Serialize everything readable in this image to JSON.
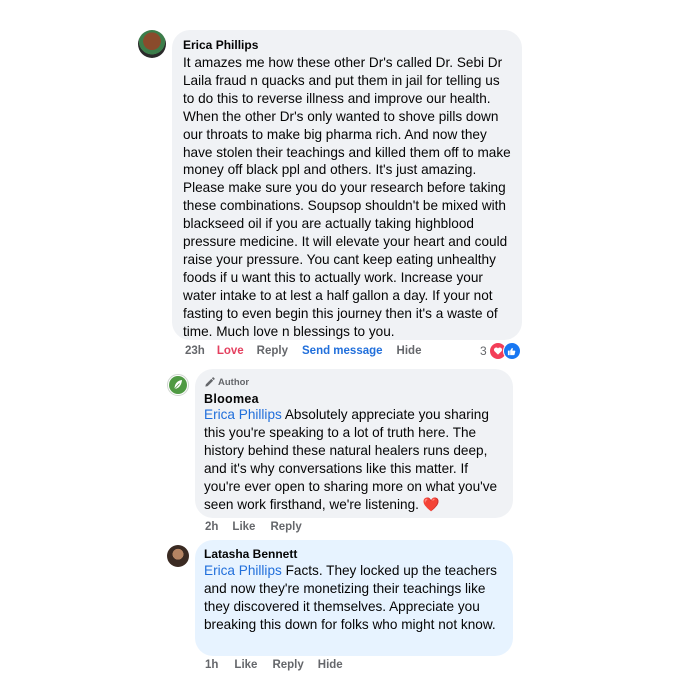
{
  "comments": [
    {
      "author": "Erica Phillips",
      "text": "It amazes me how these other Dr's called Dr. Sebi Dr Laila fraud n quacks and put them in jail for telling us to do this to reverse illness and improve our health. When the other Dr's only wanted to shove pills down our throats to make big pharma rich. And now they have stolen their teachings and killed them off to make money off black ppl and others. It's just amazing. Please make sure you do your research before taking these combinations. Soupsop shouldn't be mixed with blackseed oil if you are actually taking highblood pressure medicine. It will elevate your heart and could raise your pressure. You cant keep eating unhealthy foods if u want this to actually work. Increase your water intake to at lest a half gallon a day. If your not fasting to even begin this journey then it's a waste of time. Much love n blessings to you.",
      "time": "23h",
      "actions": [
        "Love",
        "Reply",
        "Send message",
        "Hide"
      ],
      "reaction_count": "3"
    },
    {
      "badge": "Author",
      "author": "Bloomea",
      "mention": "Erica Phillips",
      "text": "Absolutely appreciate you sharing this you're speaking to a lot of truth here. The history behind these natural healers runs deep, and it's why conversations like this matter. If you're ever open to sharing more on what you've seen work firsthand, we're listening.",
      "emoji": "❤️",
      "time": "2h",
      "actions": [
        "Like",
        "Reply"
      ]
    },
    {
      "author": "Latasha Bennett",
      "mention": "Erica Phillips",
      "text": "Facts. They locked up the teachers and now they're monetizing their teachings like they discovered it themselves. Appreciate you breaking this down for folks who might not know.",
      "time": "1h",
      "actions": [
        "Like",
        "Reply",
        "Hide"
      ]
    }
  ],
  "colors": {
    "bubble_gray": "#f0f2f5",
    "bubble_blue": "#e7f3ff",
    "mention_blue": "#216fdb",
    "love_red": "#e4405f",
    "meta_gray": "#65676b",
    "author_green": "#3f8f3a"
  },
  "icons": [
    "avatar-photo",
    "leaf-logo",
    "pencil-icon",
    "love-reaction-icon",
    "like-reaction-icon",
    "heart-emoji"
  ]
}
